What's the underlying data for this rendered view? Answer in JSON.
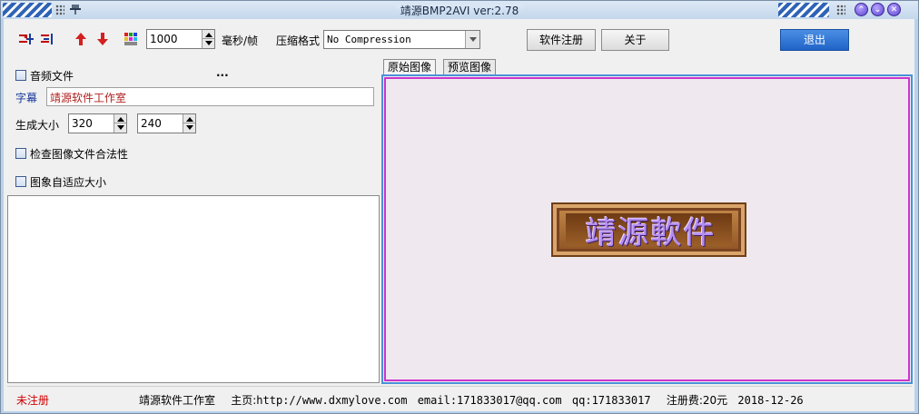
{
  "window": {
    "title": "靖源BMP2AVI ver:2.78",
    "buttons": [
      "restore",
      "minimize",
      "close"
    ]
  },
  "toolbar": {
    "icons": [
      "add-frames-icon",
      "remove-frames-icon",
      "move-up-icon",
      "move-down-icon",
      "color-palette-icon"
    ],
    "interval_value": "1000",
    "interval_unit": "毫秒/帧",
    "compression_label": "压缩格式",
    "compression_value": "No Compression",
    "register_label": "软件注册",
    "about_label": "关于",
    "exit_label": "退出"
  },
  "left": {
    "audio_label": "音频文件",
    "audio_browse": "...",
    "subtitle_label": "字幕",
    "subtitle_value": "靖源软件工作室",
    "size_label": "生成大小",
    "width_value": "320",
    "height_value": "240",
    "check_image_label": "检查图像文件合法性",
    "auto_fit_label": "图象自适应大小"
  },
  "tabs": [
    "原始图像",
    "预览图像"
  ],
  "preview": {
    "logo_text": "靖源軟件"
  },
  "status": {
    "unregistered": "未注册",
    "studio": "靖源软件工作室",
    "homepage_label": "主页:",
    "homepage": "http://www.dxmylove.com",
    "email": "email:171833017@qq.com",
    "qq": "qq:171833017",
    "fee_label": "注册费:",
    "fee": "20元",
    "date": "2018-12-26"
  },
  "colors": {
    "title_bar": "#c4d7ec",
    "accent_blue": "#2063c8",
    "status_red": "#d00000",
    "preview_border": "#cc33cc"
  }
}
